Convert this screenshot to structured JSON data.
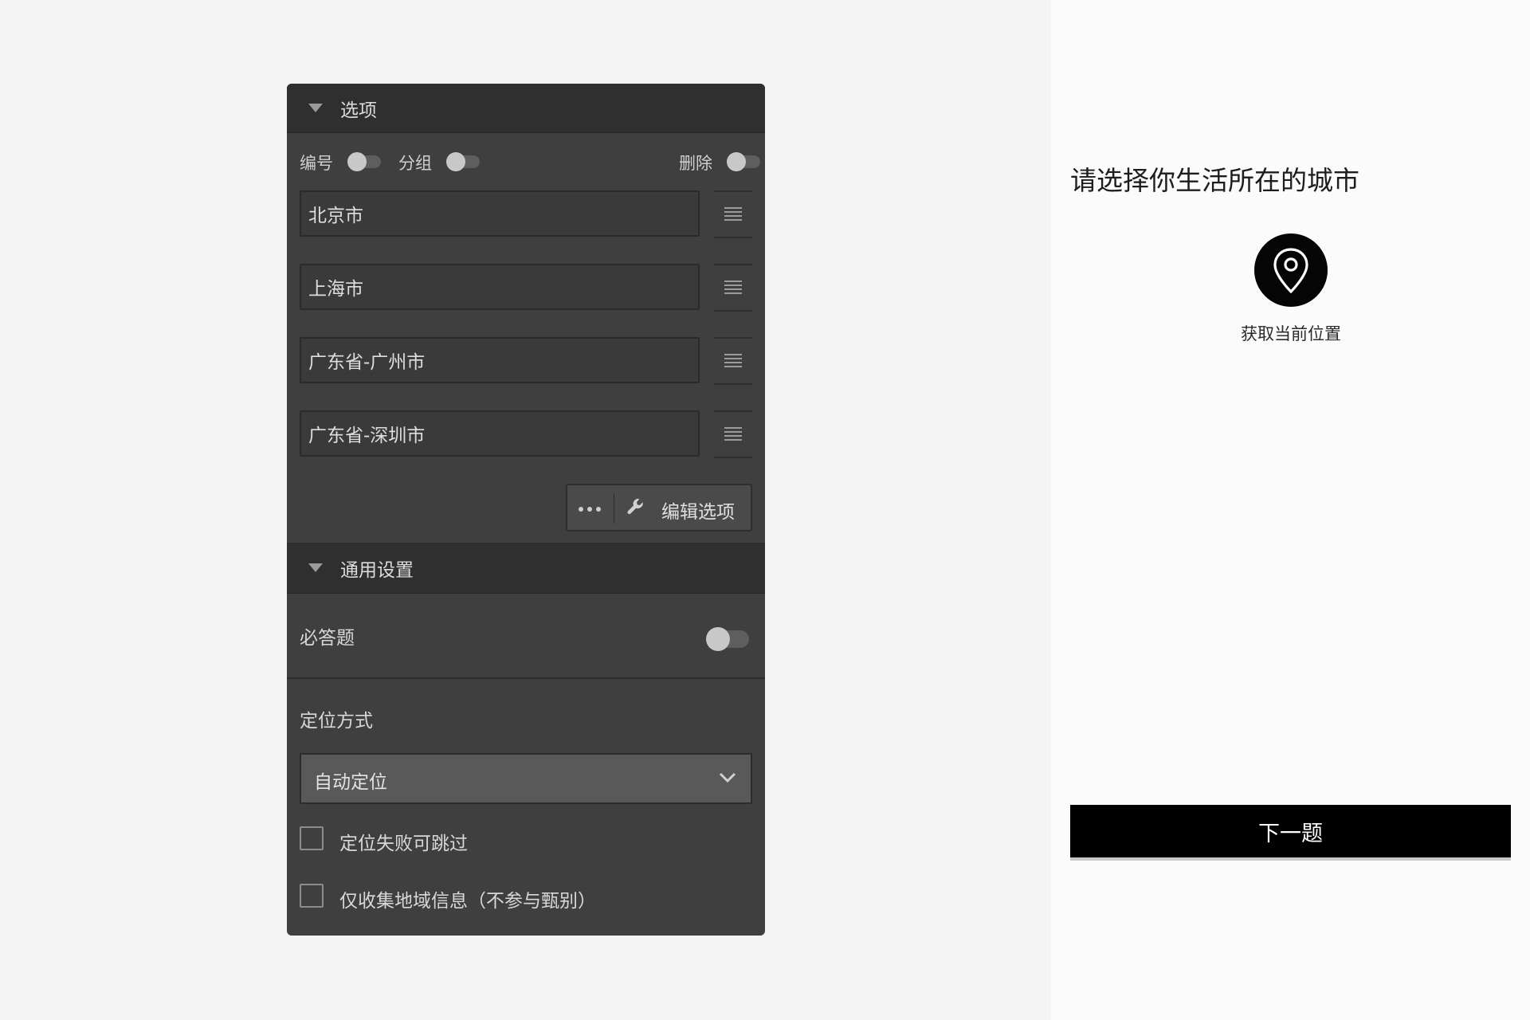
{
  "editor": {
    "options_section": {
      "title": "选项"
    },
    "toggles": {
      "numbering_label": "编号",
      "group_label": "分组",
      "delete_label": "删除"
    },
    "options": [
      {
        "label": "北京市"
      },
      {
        "label": "上海市"
      },
      {
        "label": "广东省-广州市"
      },
      {
        "label": "广东省-深圳市"
      }
    ],
    "edit_button": {
      "label": "编辑选项",
      "more_icon": "more-dots-icon",
      "tool_icon": "wrench-icon"
    },
    "general_section": {
      "title": "通用设置"
    },
    "required": {
      "label": "必答题",
      "enabled": false
    },
    "location_method": {
      "label": "定位方式",
      "selected": "自动定位"
    },
    "checkboxes": [
      {
        "label": "定位失败可跳过",
        "checked": false
      },
      {
        "label": "仅收集地域信息（不参与甄别）",
        "checked": false
      }
    ]
  },
  "preview": {
    "question_title": "请选择你生活所在的城市",
    "locate_icon": "map-pin-icon",
    "locate_label": "获取当前位置",
    "next_button": "下一题"
  },
  "colors": {
    "panel_bg": "#3f3f3f",
    "header_bg": "#2f2f2f",
    "preview_bg": "#fbfbfb",
    "primary": "#000000"
  }
}
